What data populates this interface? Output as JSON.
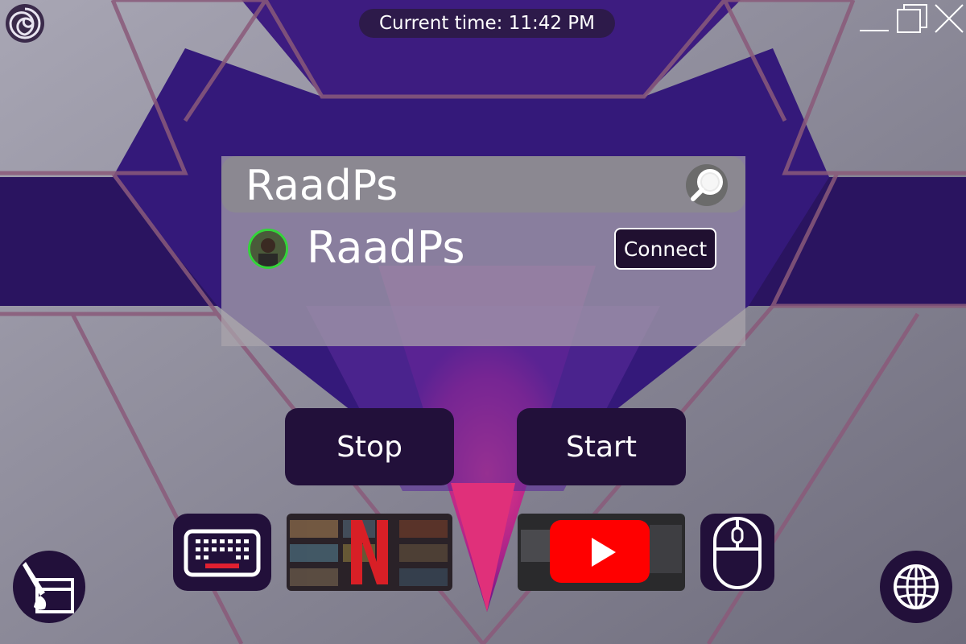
{
  "header": {
    "time_label": "Current time: 11:42 PM"
  },
  "window_controls": [
    "minimize-icon",
    "maximize-icon",
    "close-icon"
  ],
  "search": {
    "query": "RaadPs",
    "icon": "magnifier-icon"
  },
  "results": [
    {
      "name": "RaadPs",
      "status_color": "#34d43a",
      "action": "Connect"
    }
  ],
  "controls": {
    "stop_label": "Stop",
    "start_label": "Start"
  },
  "dock": {
    "items": [
      "keyboard-icon",
      "netflix-thumbnail",
      "youtube-thumbnail",
      "mouse-icon"
    ]
  },
  "corner_buttons": {
    "left": "paint-brush-icon",
    "right": "globe-icon"
  },
  "theme": {
    "panel_dark": "#22103a",
    "accent_purple": "#4a1a8a",
    "accent_pink": "#e0307a"
  }
}
